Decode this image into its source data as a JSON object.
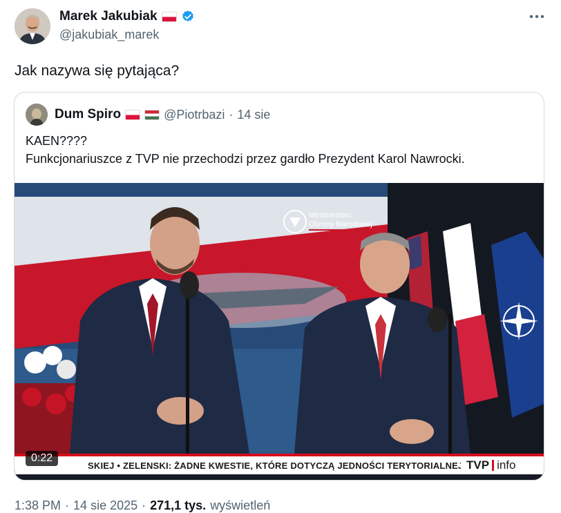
{
  "author": {
    "name": "Marek Jakubiak",
    "handle": "@jakubiak_marek",
    "verified_color": "#1d9bf0"
  },
  "tweet_text": "Jak nazywa się pytająca?",
  "quote": {
    "name": "Dum Spiro",
    "handle": "@Piotrbazi",
    "separator": "·",
    "date": "14 sie",
    "text_line1": "KAEN????",
    "text_line2": "Funkcjonariuszce z TVP nie przechodzi przez gardło Prezydent Karol Nawrocki."
  },
  "video": {
    "duration": "0:22",
    "ticker": "SKIEJ • ZELENSKI: ŻADNE KWESTIE, KTÓRE DOTYCZĄ JEDNOŚCI TERYTORIALNEJ NASZEGO P",
    "channel_left": "TVP",
    "channel_right": "info",
    "backdrop_line1": "Ministerstwo",
    "backdrop_line2": "Obrony Narodowej"
  },
  "meta": {
    "time": "1:38 PM",
    "sep1": "·",
    "date": "14 sie 2025",
    "sep2": "·",
    "views": "271,1 tys.",
    "views_label": "wyświetleń"
  },
  "icons": {
    "more": "more-horizontal-icon",
    "verified": "verified-badge-icon"
  }
}
